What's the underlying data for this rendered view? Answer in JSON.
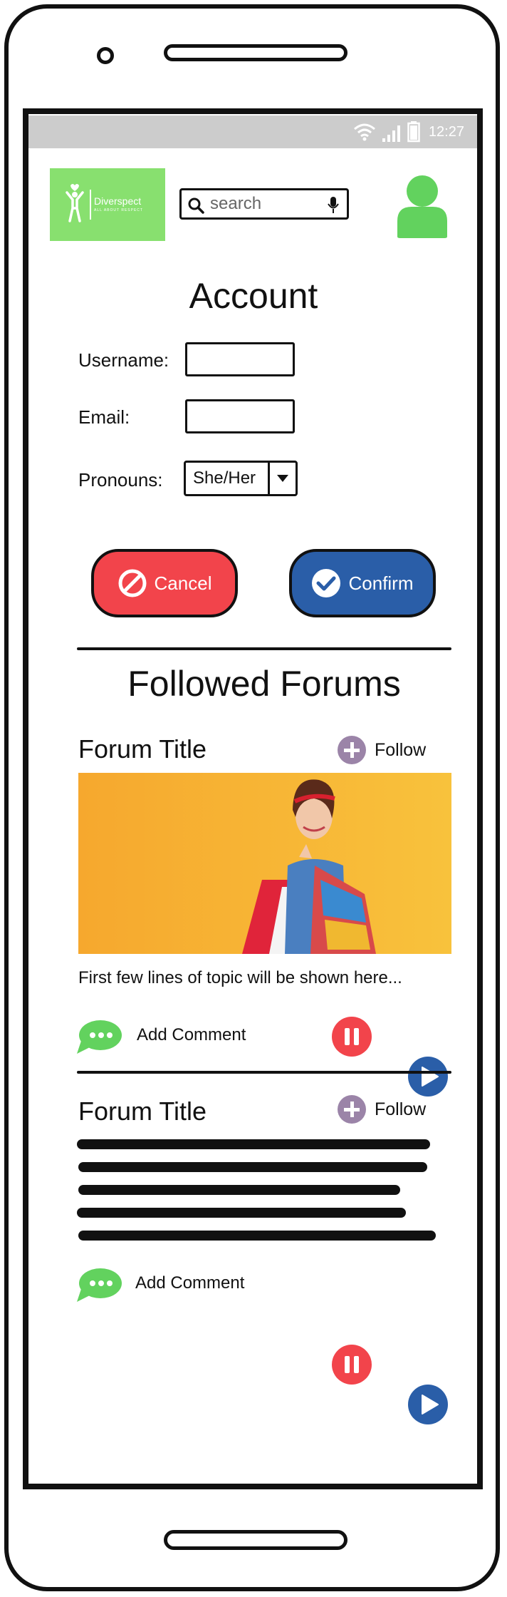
{
  "status_bar": {
    "time": "12:27"
  },
  "header": {
    "logo_text": "Diverspect",
    "logo_sub": "ALL ABOUT RESPECT",
    "search": {
      "placeholder": "search"
    }
  },
  "account": {
    "title": "Account",
    "username_label": "Username:",
    "email_label": "Email:",
    "pronouns_label": "Pronouns:",
    "pronouns_value": "She/Her",
    "cancel_label": "Cancel",
    "confirm_label": "Confirm"
  },
  "forums": {
    "heading": "Followed Forums",
    "items": [
      {
        "title": "Forum Title",
        "follow_label": "Follow",
        "preview_text": "First few lines of topic will be shown here...",
        "comment_label": "Add Comment"
      },
      {
        "title": "Forum Title",
        "follow_label": "Follow",
        "comment_label": "Add Comment"
      }
    ]
  },
  "colors": {
    "logo_bg": "#88e06f",
    "avatar": "#62d25e",
    "cancel": "#f2444b",
    "confirm": "#2a5ea8",
    "follow_icon": "#9b84a8",
    "status_bar": "#cccccc"
  }
}
